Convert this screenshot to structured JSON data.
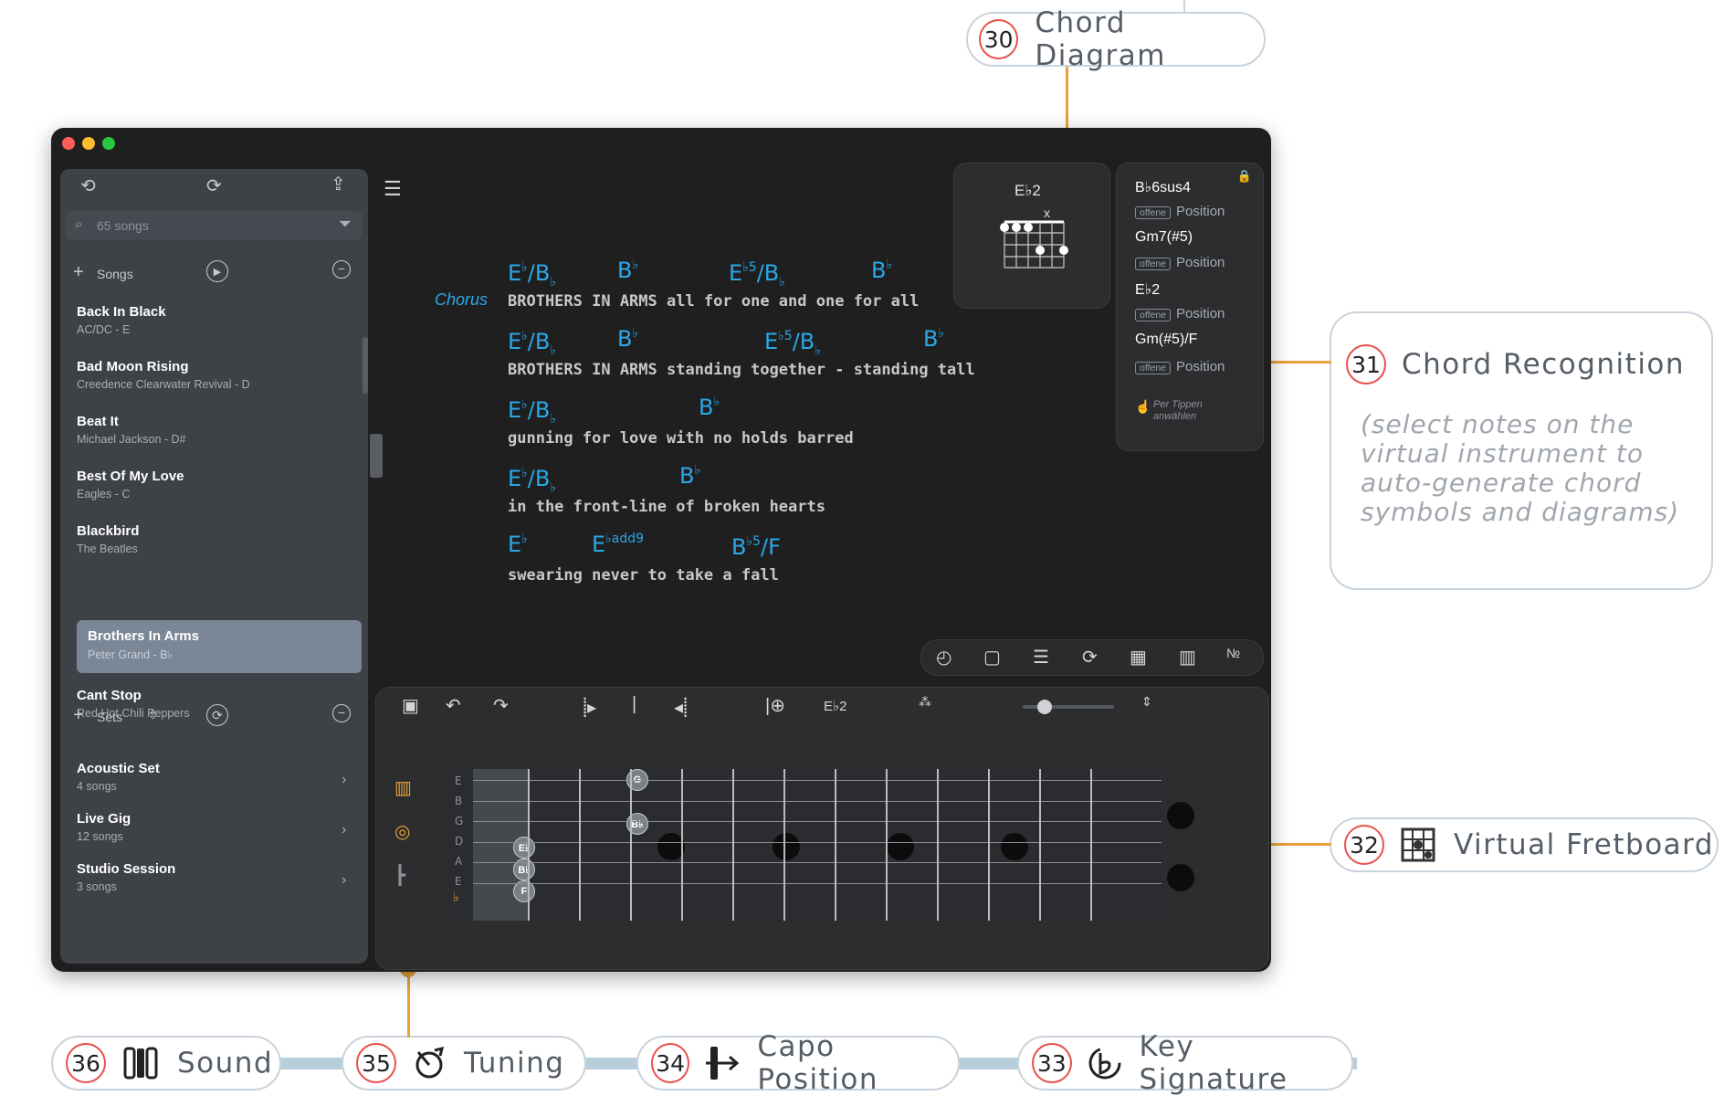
{
  "callouts": {
    "c30": {
      "num": "30",
      "label": "Chord Diagram"
    },
    "c31": {
      "num": "31",
      "label": "Chord Recognition",
      "description": "(select notes on the virtual instrument to auto-generate chord symbols and diagrams)"
    },
    "c32": {
      "num": "32",
      "label": "Virtual Fretboard"
    },
    "c33": {
      "num": "33",
      "label": "Key Signature"
    },
    "c34": {
      "num": "34",
      "label": "Capo Position"
    },
    "c35": {
      "num": "35",
      "label": "Tuning"
    },
    "c36": {
      "num": "36",
      "label": "Sound"
    }
  },
  "colors": {
    "accent": "#e9a13b",
    "chord": "#2aa8e8",
    "callout_number_ring": "#e8504a"
  },
  "sidebar": {
    "search_placeholder": "65 songs",
    "songs_header": "Songs",
    "songs": [
      {
        "title": "Back In Black",
        "sub": "AC/DC - E"
      },
      {
        "title": "Bad Moon Rising",
        "sub": "Creedence Clearwater Revival - D"
      },
      {
        "title": "Beat It",
        "sub": "Michael Jackson - D#"
      },
      {
        "title": "Best Of My Love",
        "sub": "Eagles - C"
      },
      {
        "title": "Blackbird",
        "sub": "The Beatles"
      },
      {
        "title": "Brothers In Arms",
        "sub": "Peter Grand - B♭"
      },
      {
        "title": "Cant Stop",
        "sub": "Red Hot Chili Peppers"
      }
    ],
    "sets_header": "Sets",
    "sets": [
      {
        "title": "Acoustic Set",
        "sub": "4 songs"
      },
      {
        "title": "Live Gig",
        "sub": "12 songs"
      },
      {
        "title": "Studio Session",
        "sub": "3 songs"
      }
    ]
  },
  "song": {
    "section_label": "Chorus",
    "lines": [
      {
        "lyric": "BROTHERS IN ARMS all for one and one for all"
      },
      {
        "lyric": "BROTHERS IN ARMS standing together - standing tall"
      },
      {
        "lyric": "gunning for love with no holds barred"
      },
      {
        "lyric": "in the front-line of broken hearts"
      },
      {
        "lyric": "swearing never to take a fall"
      }
    ]
  },
  "chord_diagram": {
    "name": "E♭2",
    "mute_mark": "x"
  },
  "chord_recognition": {
    "items": [
      {
        "chord": "B♭6sus4",
        "position": "Position",
        "badge": "offene"
      },
      {
        "chord": "Gm7(#5)",
        "position": "Position",
        "badge": "offene"
      },
      {
        "chord": "E♭2",
        "position": "Position",
        "badge": "offene"
      },
      {
        "chord": "Gm(#5)/F",
        "position": "Position",
        "badge": "offene"
      }
    ],
    "hint": "Per Tippen anwählen"
  },
  "fretboard": {
    "toolbar_chord": "E♭2",
    "strings": [
      "E",
      "B",
      "G",
      "D",
      "A",
      "E"
    ],
    "slider_value": 0.2,
    "notes": [
      "G",
      "B♭",
      "E♭",
      "B♭",
      "F"
    ]
  }
}
